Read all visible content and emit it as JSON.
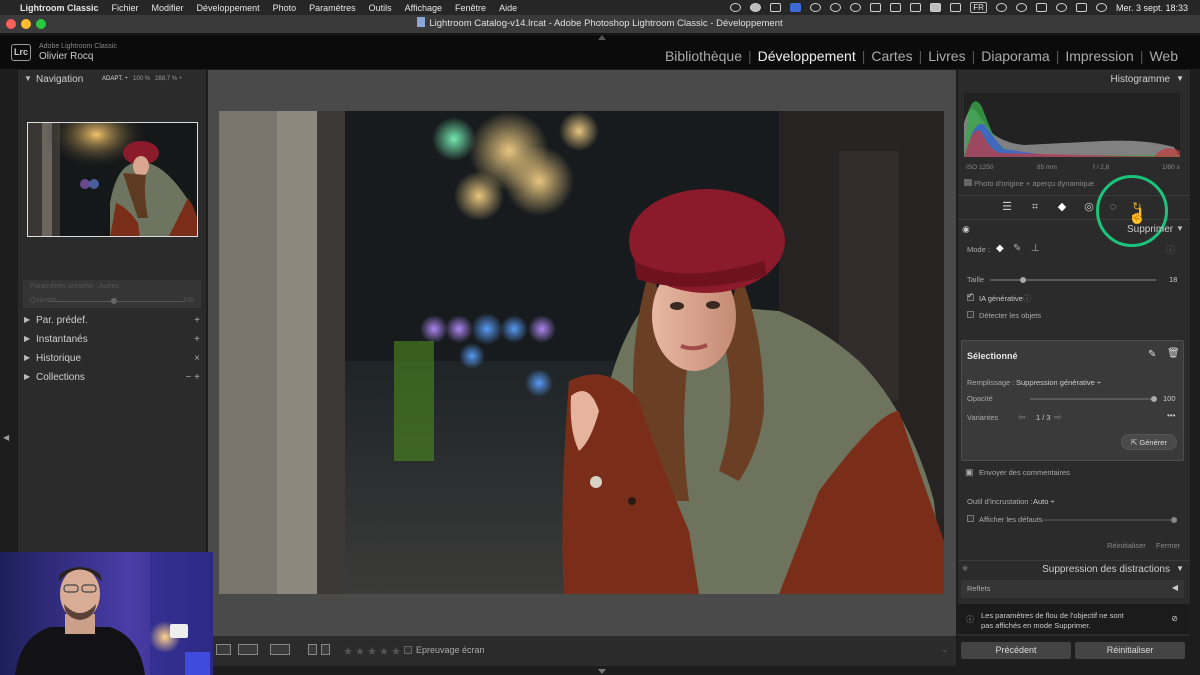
{
  "menubar": {
    "app": "Lightroom Classic",
    "items": [
      "Fichier",
      "Modifier",
      "Développement",
      "Photo",
      "Paramètres",
      "Outils",
      "Affichage",
      "Fenêtre",
      "Aide"
    ],
    "input_source": "FR",
    "datetime": "Mer. 3 sept. 18:33"
  },
  "window": {
    "title": "Lightroom Catalog-v14.lrcat - Adobe Photoshop Lightroom Classic - Développement"
  },
  "identity": {
    "logo": "Lrc",
    "product": "Adobe Lightroom Classic",
    "user": "Olivier Rocq"
  },
  "modules": [
    "Bibliothèque",
    "Développement",
    "Cartes",
    "Livres",
    "Diaporama",
    "Impression",
    "Web"
  ],
  "active_module": "Développement",
  "left_panel": {
    "navigator_title": "Navigation",
    "navigator_options": [
      "ADAPT. ÷",
      "100 %",
      "288,7 % ÷"
    ],
    "dim_preset_label": "Paramètres prédéfin : Autres",
    "dim_quantity_label": "Quantité",
    "dim_quantity_value": "100",
    "sections": [
      {
        "label": "Par. prédef.",
        "action": "+"
      },
      {
        "label": "Instantanés",
        "action": "+"
      },
      {
        "label": "Historique",
        "action": "×"
      },
      {
        "label": "Collections",
        "action": "− +"
      }
    ]
  },
  "toolbar": {
    "proofing_label": "Epreuvage écran",
    "stars": [
      "★",
      "★",
      "★",
      "★",
      "★"
    ],
    "view_buttons": [
      "▭",
      "R|R",
      "Y|Y"
    ]
  },
  "right_panel": {
    "histogram_title": "Histogramme",
    "iso": "ISO 1250",
    "focal": "85 mm",
    "aperture": "f / 2,8",
    "shutter": "1/80 s",
    "original_label": "Photo d'origine + aperçu dynamique",
    "tools": [
      "sliders-icon",
      "crop-icon",
      "eraser-icon",
      "redeye-icon",
      "mask-icon",
      "refresh-icon"
    ],
    "remove_title": "Supprimer",
    "mode_label": "Mode :",
    "size_label": "Taille",
    "size_value": "18",
    "size_level": 0.2,
    "ai_label": "IA générative",
    "ai_checked": true,
    "detect_label": "Détecter les objets",
    "selected": {
      "title": "Sélectionné",
      "fill_label": "Remplissage :",
      "fill_value": "Suppression générative ÷",
      "opacity_label": "Opacité",
      "opacity_value": "100",
      "opacity_level": 1.0,
      "variants_label": "Variantes",
      "variants_value": "1 / 3",
      "more": "•••",
      "generate_label": "Générer"
    },
    "feedback_label": "Envoyer des commentaires",
    "overlay_label": "Outil d'incrustation :",
    "overlay_value": "Auto ÷",
    "show_defaults_label": "Afficher les défauts",
    "reset_label": "Réinitialiser",
    "close_label": "Fermer",
    "distractions_title": "Suppression des distractions",
    "reflections_label": "Reflets",
    "info_text_1": "Les paramètres de flou de l'objectif ne sont",
    "info_text_2": "pas affichés en mode Supprimer.",
    "prev_button": "Précédent",
    "reset_button": "Réinitialiser"
  },
  "colors": {
    "accent_ring": "#1bc47b",
    "panel_bg": "#2b2b2b",
    "beret": "#8b1a2a",
    "coat": "#7a2e1a"
  }
}
